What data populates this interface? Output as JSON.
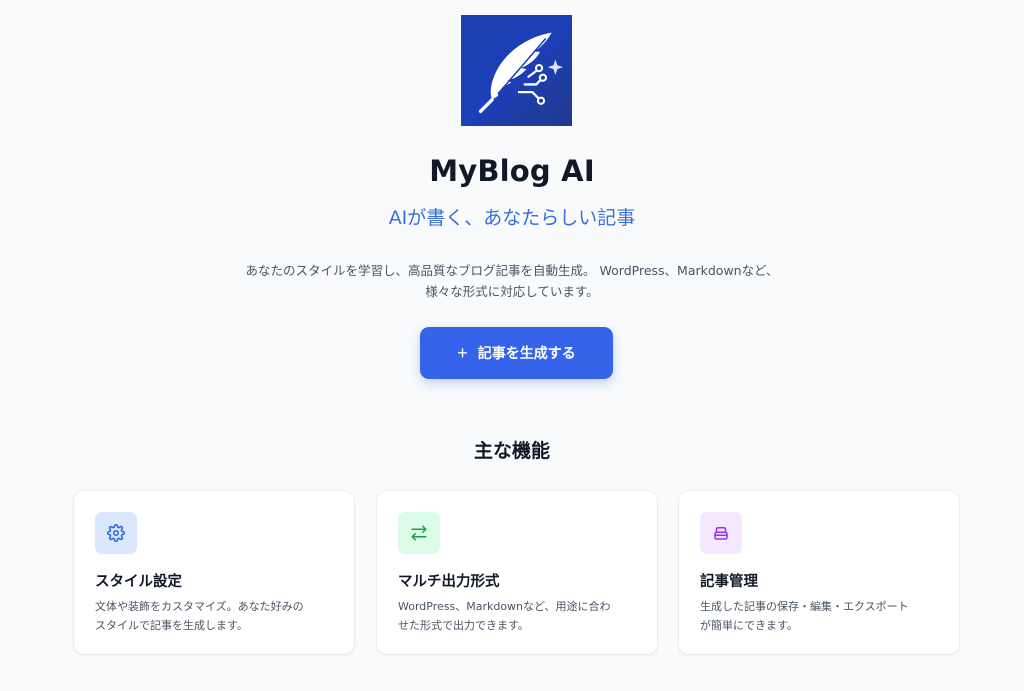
{
  "app": {
    "name": "MyBlog AI",
    "tagline": "AIが書く、あなたらしい記事",
    "description_line1": "あなたのスタイルを学習し、高品質なブログ記事を自動生成。 WordPress、Markdownなど、",
    "description_line2": "様々な形式に対応しています。",
    "logo_icon": "quill-circuit-icon"
  },
  "cta": {
    "icon": "+",
    "label": "記事を生成する"
  },
  "features": {
    "title": "主な機能",
    "items": [
      {
        "icon": "gear-icon",
        "title": "スタイル設定",
        "line1": "文体や装飾をカスタマイズ。あなた好みの",
        "line2": "スタイルで記事を生成します。"
      },
      {
        "icon": "swap-arrows-icon",
        "title": "マルチ出力形式",
        "line1": "WordPress、Markdownなど、用途に合わ",
        "line2": "せた形式で出力できます。"
      },
      {
        "icon": "archive-icon",
        "title": "記事管理",
        "line1": "生成した記事の保存・編集・エクスポート",
        "line2": "が簡単にできます。"
      }
    ]
  },
  "colors": {
    "accent": "#3563e9",
    "tagline": "#3b6fd8",
    "icon_blue": "#2563eb",
    "icon_green": "#16a34a",
    "icon_purple": "#9333ea"
  }
}
